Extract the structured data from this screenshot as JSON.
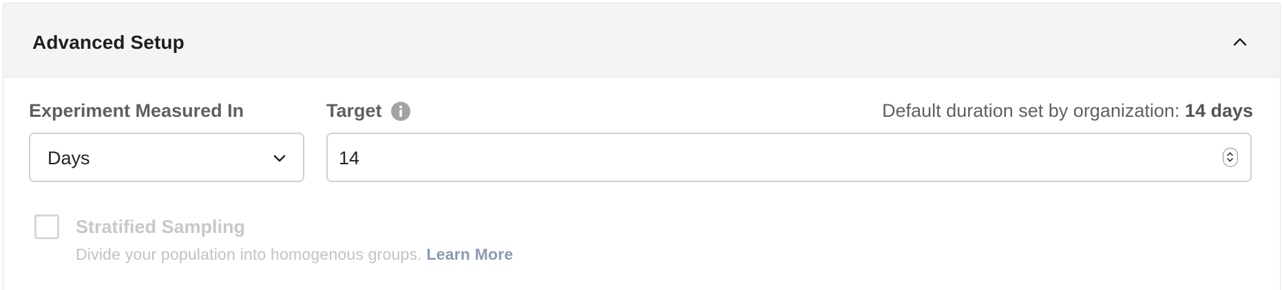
{
  "section": {
    "title": "Advanced Setup",
    "collapse_icon": "chevron-up-icon"
  },
  "measured_in": {
    "label": "Experiment Measured In",
    "selected": "Days",
    "chevron_icon": "chevron-down-icon"
  },
  "target": {
    "label": "Target",
    "info_icon": "info-icon",
    "value": "14",
    "default_prefix": "Default duration set by organization:",
    "default_value": "14 days"
  },
  "stratified": {
    "label": "Stratified Sampling",
    "checked": false,
    "description": "Divide your population into homogenous groups.",
    "link": "Learn More"
  },
  "colors": {
    "header_bg": "#f4f4f4",
    "label_text": "#5f5f5f",
    "disabled_text": "#c8c8c8",
    "link_disabled": "#8a9bb2",
    "border": "#cfcfcf"
  }
}
